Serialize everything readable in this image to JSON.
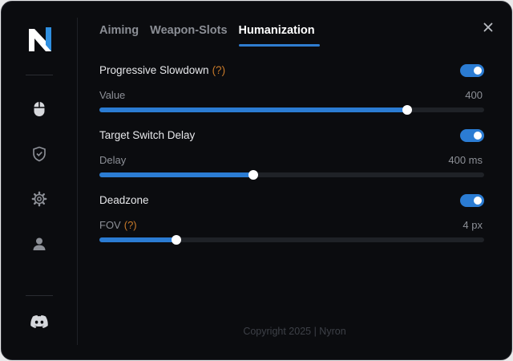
{
  "app": {
    "logo_letter": "N",
    "footer": "Copyright 2025 | Nyron"
  },
  "sidebar": {
    "items": [
      {
        "icon": "mouse-icon"
      },
      {
        "icon": "shield-icon"
      },
      {
        "icon": "gear-icon"
      },
      {
        "icon": "user-icon"
      }
    ],
    "bottom": {
      "icon": "discord-icon"
    }
  },
  "tabs": [
    {
      "label": "Aiming",
      "active": false
    },
    {
      "label": "Weapon-Slots",
      "active": false
    },
    {
      "label": "Humanization",
      "active": true
    }
  ],
  "settings": [
    {
      "title": "Progressive Slowdown",
      "help": "(?)",
      "enabled": true,
      "slider": {
        "label": "Value",
        "help": "",
        "value_text": "400",
        "fraction": 0.8
      }
    },
    {
      "title": "Target Switch Delay",
      "help": "",
      "enabled": true,
      "slider": {
        "label": "Delay",
        "help": "",
        "value_text": "400 ms",
        "fraction": 0.4
      }
    },
    {
      "title": "Deadzone",
      "help": "",
      "enabled": true,
      "slider": {
        "label": "FOV",
        "help": "(?)",
        "value_text": "4 px",
        "fraction": 0.2
      }
    }
  ],
  "colors": {
    "accent": "#2b7cd3",
    "help": "#c97a2a",
    "background": "#0b0c0f"
  }
}
